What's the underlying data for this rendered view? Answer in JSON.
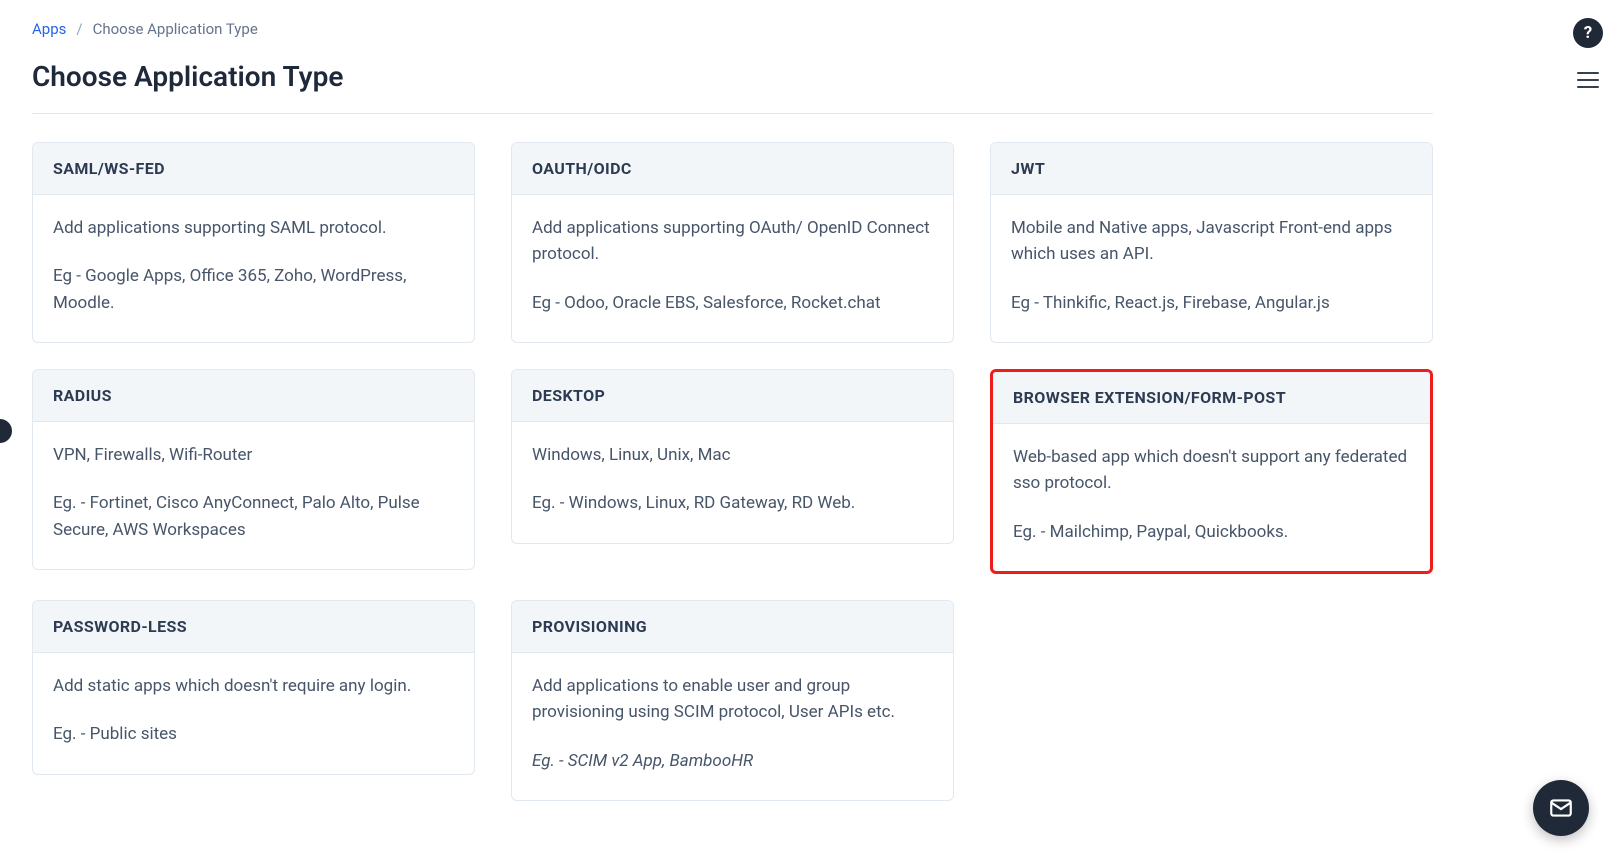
{
  "breadcrumb": {
    "root": "Apps",
    "current": "Choose Application Type"
  },
  "page_title": "Choose Application Type",
  "cards": [
    {
      "title": "SAML/WS-FED",
      "desc": "Add applications supporting SAML protocol.",
      "example": "Eg - Google Apps, Office 365, Zoho, WordPress, Moodle.",
      "highlight": false,
      "italic_example": false
    },
    {
      "title": "OAUTH/OIDC",
      "desc": "Add applications supporting OAuth/ OpenID Connect protocol.",
      "example": "Eg - Odoo, Oracle EBS, Salesforce, Rocket.chat",
      "highlight": false,
      "italic_example": false
    },
    {
      "title": "JWT",
      "desc": "Mobile and Native apps, Javascript Front-end apps which uses an API.",
      "example": "Eg - Thinkific, React.js, Firebase, Angular.js",
      "highlight": false,
      "italic_example": false
    },
    {
      "title": "RADIUS",
      "desc": "VPN, Firewalls, Wifi-Router",
      "example": "Eg. - Fortinet, Cisco AnyConnect, Palo Alto, Pulse Secure, AWS Workspaces",
      "highlight": false,
      "italic_example": false
    },
    {
      "title": "DESKTOP",
      "desc": "Windows, Linux, Unix, Mac",
      "example": "Eg. - Windows, Linux, RD Gateway, RD Web.",
      "highlight": false,
      "italic_example": false
    },
    {
      "title": "BROWSER EXTENSION/FORM-POST",
      "desc": "Web-based app which doesn't support any federated sso protocol.",
      "example": "Eg. - Mailchimp, Paypal, Quickbooks.",
      "highlight": true,
      "italic_example": false
    },
    {
      "title": "PASSWORD-LESS",
      "desc": "Add static apps which doesn't require any login.",
      "example": "Eg. - Public sites",
      "highlight": false,
      "italic_example": false
    },
    {
      "title": "PROVISIONING",
      "desc": "Add applications to enable user and group provisioning using SCIM protocol, User APIs etc.",
      "example": "Eg. - SCIM v2 App, BambooHR",
      "highlight": false,
      "italic_example": true
    }
  ],
  "rail": {
    "help_symbol": "?"
  }
}
